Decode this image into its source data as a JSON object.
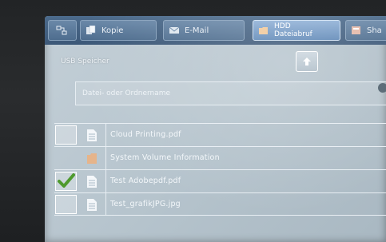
{
  "tabs": [
    {
      "label": "Kopie",
      "icon": "copy-icon",
      "active": false
    },
    {
      "label": "E-Mail",
      "icon": "email-icon",
      "active": false
    },
    {
      "label_line1": "HDD",
      "label_line2": "Dateiabruf",
      "icon": "folder-icon",
      "active": true
    },
    {
      "label": "Sha",
      "icon": "share-icon",
      "active": false
    }
  ],
  "location": {
    "title": "USB Speicher",
    "up_icon": "arrow-up-icon"
  },
  "name_field": {
    "placeholder": "Datei- oder Ordnername"
  },
  "files": [
    {
      "name": "Cloud Printing.pdf",
      "type": "file",
      "checked": false,
      "has_checkbox": true
    },
    {
      "name": "System Volume Information",
      "type": "folder",
      "checked": false,
      "has_checkbox": false
    },
    {
      "name": "Test Adobepdf.pdf",
      "type": "file",
      "checked": true,
      "has_checkbox": true
    },
    {
      "name": "Test_grafikJPG.jpg",
      "type": "file",
      "checked": false,
      "has_checkbox": true
    }
  ],
  "colors": {
    "tab_bar": "#4c6b8c",
    "active_tab": "#8fb0d6",
    "screen_bg": "#b6c4cd",
    "check_green": "#4e9a2e",
    "folder": "#e6b48a"
  }
}
